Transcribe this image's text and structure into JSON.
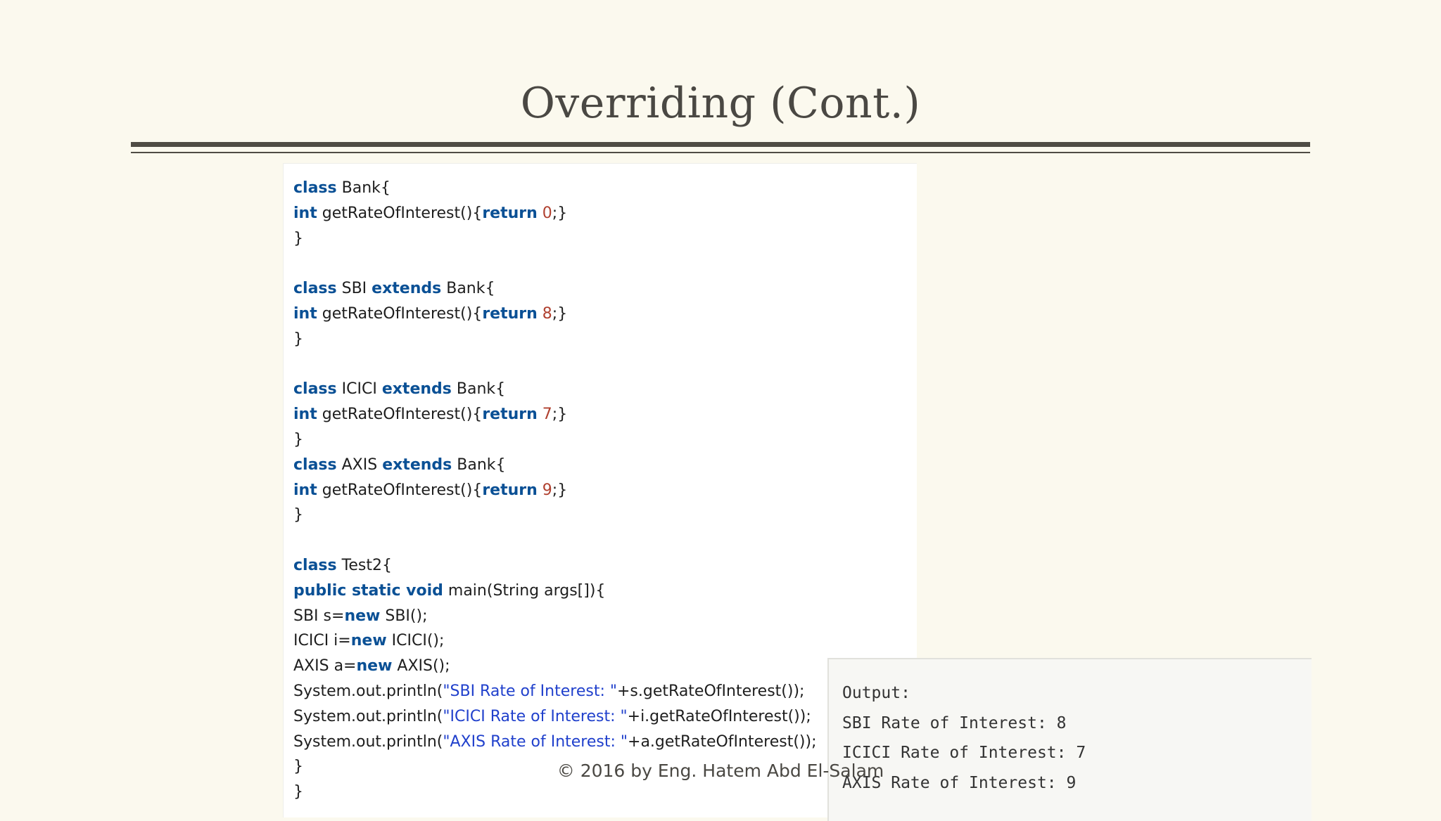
{
  "slide": {
    "title": "Overriding (Cont.)",
    "footer": "©  2016 by Eng.  Hatem Abd El-Salam"
  },
  "code": {
    "bank_class_kw": "class",
    "bank_name": " Bank{",
    "bank_int": "int",
    "bank_method": " getRateOfInterest(){",
    "bank_return": "return",
    "bank_value": " 0",
    "bank_end": ";}",
    "bank_close": "}",
    "sbi_class_kw": "class",
    "sbi_name": " SBI ",
    "sbi_extends": "extends",
    "sbi_parent": " Bank{",
    "sbi_int": "int",
    "sbi_method": " getRateOfInterest(){",
    "sbi_return": "return",
    "sbi_value": " 8",
    "sbi_end": ";}",
    "sbi_close": "}",
    "icici_class_kw": "class",
    "icici_name": " ICICI ",
    "icici_extends": "extends",
    "icici_parent": " Bank{",
    "icici_int": "int",
    "icici_method": " getRateOfInterest(){",
    "icici_return": "return",
    "icici_value": " 7",
    "icici_end": ";}",
    "icici_close": "}",
    "axis_class_kw": "class",
    "axis_name": " AXIS ",
    "axis_extends": "extends",
    "axis_parent": " Bank{",
    "axis_int": "int",
    "axis_method": " getRateOfInterest(){",
    "axis_return": "return",
    "axis_value": " 9",
    "axis_end": ";}",
    "axis_close": "}",
    "test_class_kw": "class",
    "test_name": " Test2{",
    "main_mods": "public static void",
    "main_sig": " main(String args[]){",
    "sbi_decl": "SBI s=",
    "sbi_new": "new",
    "sbi_ctor": " SBI();",
    "icici_decl": "ICICI i=",
    "icici_new": "new",
    "icici_ctor": " ICICI();",
    "axis_decl": "AXIS a=",
    "axis_new": "new",
    "axis_ctor": " AXIS();",
    "print1_pre": "System.out.println(",
    "print1_str": "\"SBI Rate of Interest: \"",
    "print1_post": "+s.getRateOfInterest());",
    "print2_pre": "System.out.println(",
    "print2_str": "\"ICICI Rate of Interest: \"",
    "print2_post": "+i.getRateOfInterest());",
    "print3_pre": "System.out.println(",
    "print3_str": "\"AXIS Rate of Interest: \"",
    "print3_post": "+a.getRateOfInterest());",
    "main_close": "}",
    "class_close": "}"
  },
  "output": {
    "heading": "Output:",
    "lines": [
      "SBI Rate of Interest: 8",
      "ICICI Rate of Interest: 7",
      "AXIS Rate of Interest: 9"
    ]
  },
  "colors": {
    "background": "#fbf9ee",
    "keyword": "#0a5095",
    "number": "#b0402f",
    "string": "#2040cc",
    "rule": "#4f4c44"
  }
}
